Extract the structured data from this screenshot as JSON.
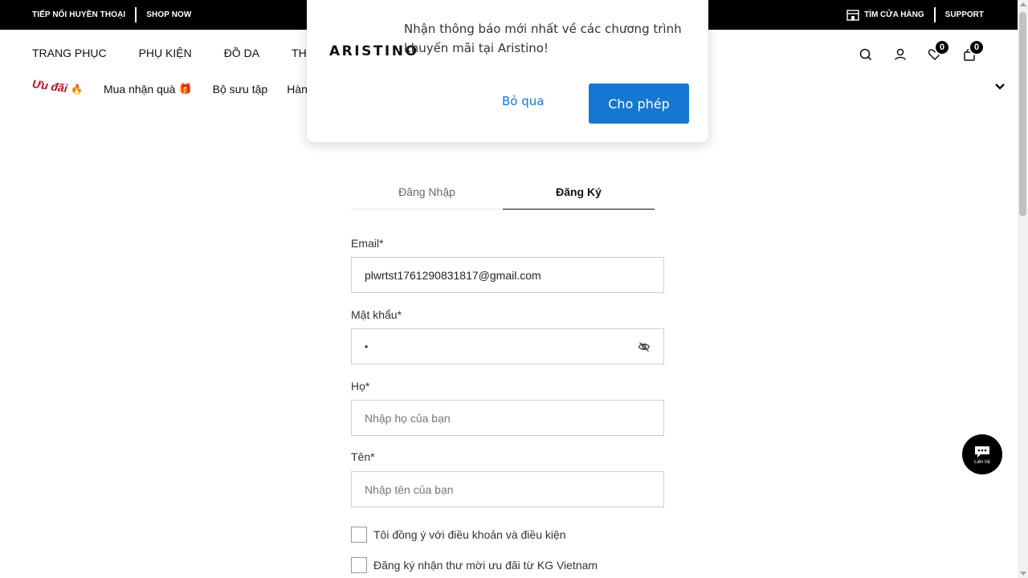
{
  "topbar": {
    "promo_text": "TIẾP NỐI HUYỀN THOẠI",
    "shop_now": "SHOP NOW",
    "find_store": "TÌM CỬA HÀNG",
    "support": "SUPPORT"
  },
  "main_nav": {
    "items": [
      "TRANG PHỤC",
      "PHỤ KIỆN",
      "ĐỒ DA",
      "THƯC"
    ],
    "wishlist_count": "0",
    "cart_count": "0"
  },
  "sub_nav": {
    "sale": "Ưu đãi",
    "gift": "Mua nhận quà",
    "collection": "Bộ sưu tập",
    "partial": "Hàn"
  },
  "notification": {
    "logo": "ARISTINO",
    "message": "Nhận thông báo mới nhất về các chương trình khuyến mãi tại Aristino!",
    "skip": "Bỏ qua",
    "allow": "Cho phép",
    "allow_color": "#1677d2"
  },
  "tabs": {
    "login": "Đăng Nhập",
    "register": "Đăng Ký"
  },
  "form": {
    "email_label": "Email*",
    "email_value": "plwrtst1761290831817@gmail.com",
    "password_label": "Mật khẩu*",
    "password_value": "•",
    "last_name_label": "Họ*",
    "last_name_placeholder": "Nhập họ của bạn",
    "first_name_label": "Tên*",
    "first_name_placeholder": "Nhập tên của bạn",
    "terms": "Tôi đồng ý với điều khoản và điều kiện",
    "newsletter": "Đăng ký nhận thư mời ưu đãi từ KG Vietnam"
  },
  "chat": {
    "label": "Liên hệ"
  }
}
